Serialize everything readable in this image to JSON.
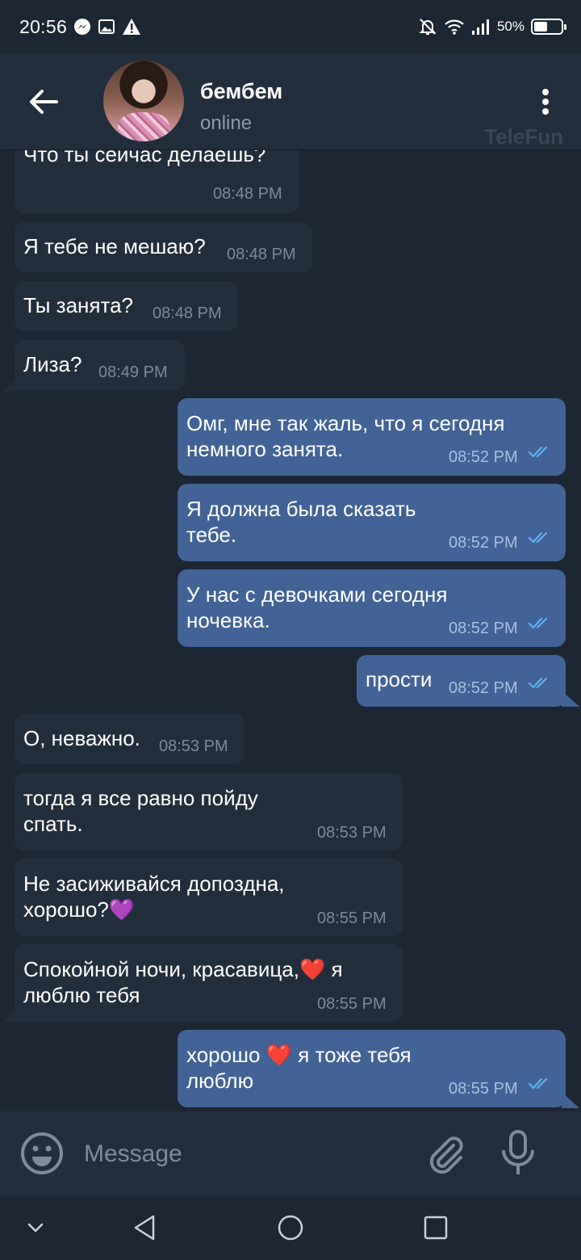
{
  "status_bar": {
    "time": "20:56",
    "battery": "50%",
    "battery_level": 0.5
  },
  "header": {
    "contact_name": "бембем",
    "contact_status": "online",
    "watermark": "TeleFun"
  },
  "messages": [
    {
      "direction": "in",
      "text_lines": [
        "Что ты сейчас делаешь?"
      ],
      "time": "08:48 PM"
    },
    {
      "direction": "in",
      "text_lines": [
        "Я тебе не мешаю?"
      ],
      "time": "08:48 PM"
    },
    {
      "direction": "in",
      "text_lines": [
        "Ты занята?"
      ],
      "time": "08:48 PM"
    },
    {
      "direction": "in",
      "text_lines": [
        "Лиза?"
      ],
      "time": "08:49 PM"
    },
    {
      "direction": "out",
      "text_lines": [
        "Омг, мне так жаль, что я сегодня",
        "немного занята."
      ],
      "time": "08:52 PM",
      "read": true
    },
    {
      "direction": "out",
      "text_lines": [
        "Я должна была сказать",
        "тебе."
      ],
      "time": "08:52 PM",
      "read": true
    },
    {
      "direction": "out",
      "text_lines": [
        "У нас с девочками сегодня",
        "ночевка."
      ],
      "time": "08:52 PM",
      "read": true
    },
    {
      "direction": "out",
      "text_lines": [
        "прости"
      ],
      "time": "08:52 PM",
      "read": true
    },
    {
      "direction": "in",
      "text_lines": [
        "О, неважно."
      ],
      "time": "08:53 PM"
    },
    {
      "direction": "in",
      "text_lines": [
        "тогда я все равно пойду",
        "спать."
      ],
      "time": "08:53 PM"
    },
    {
      "direction": "in",
      "text_lines": [
        "Не засиживайся допоздна,",
        "хорошо?💜"
      ],
      "time": "08:55 PM"
    },
    {
      "direction": "in",
      "text_lines": [
        "Спокойной ночи, красавица,❤️ я",
        "люблю тебя"
      ],
      "time": "08:55 PM"
    },
    {
      "direction": "out",
      "text_lines": [
        "хорошо ❤️ я тоже тебя",
        "люблю"
      ],
      "time": "08:55 PM",
      "read": true
    }
  ],
  "input": {
    "placeholder": "Message"
  },
  "icons": {
    "back": "arrow-left-icon",
    "menu": "more-vertical-icon",
    "emoji": "smiley-icon",
    "attach": "paperclip-icon",
    "mic": "microphone-icon",
    "read_receipt": "double-check-icon",
    "nav_down": "chevron-down-icon",
    "nav_back": "triangle-back-icon",
    "nav_home": "circle-home-icon",
    "nav_recents": "square-recents-icon"
  },
  "colors": {
    "background": "#1d2633",
    "header": "#232e3c",
    "incoming_bubble": "#232e3c",
    "outgoing_bubble": "#416396",
    "read_check": "#5fb0f0"
  }
}
